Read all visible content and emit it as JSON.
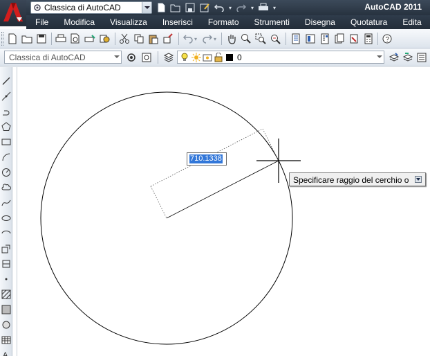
{
  "titlebar": {
    "workspace": "Classica di AutoCAD",
    "app_title": "AutoCAD 2011"
  },
  "menu": [
    "File",
    "Modifica",
    "Visualizza",
    "Inserisci",
    "Formato",
    "Strumenti",
    "Disegna",
    "Quotatura",
    "Edita"
  ],
  "toolbar2": {
    "workspace": "Classica di AutoCAD",
    "layer_name": "0"
  },
  "canvas": {
    "radius_input": "710.1338",
    "prompt": "Specificare raggio del cerchio o"
  }
}
